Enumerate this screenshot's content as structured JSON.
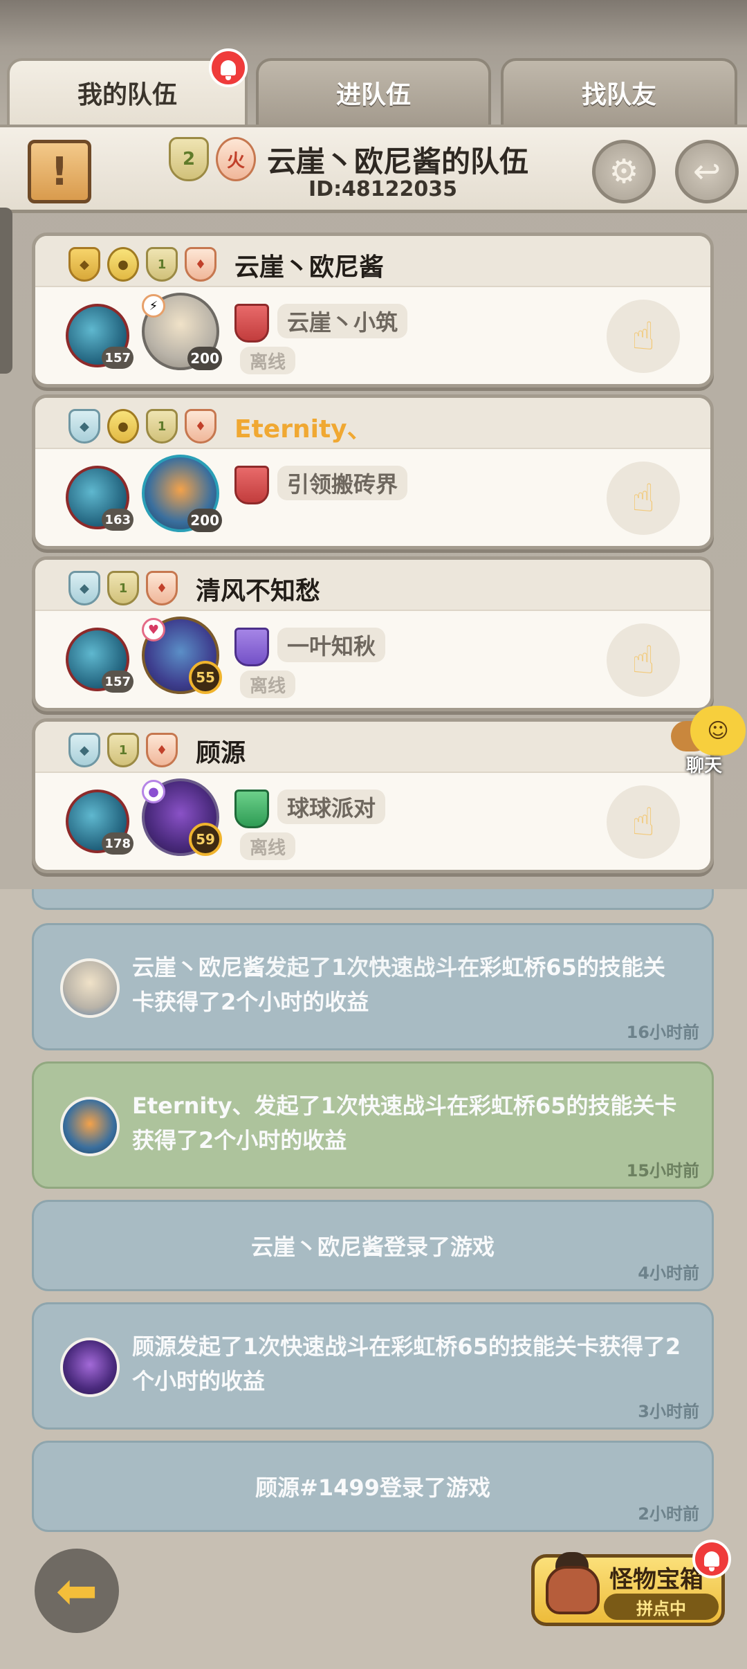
{
  "tabs": [
    {
      "label": "我的队伍",
      "active": true,
      "has_alert": true
    },
    {
      "label": "进队伍",
      "active": false
    },
    {
      "label": "找队友",
      "active": false
    }
  ],
  "header": {
    "team_title": "云崖丶欧尼酱的队伍",
    "team_id": "ID:48122035",
    "emblem_1": "2",
    "emblem_2": "火"
  },
  "members": [
    {
      "name": "云崖丶欧尼酱",
      "name_color": "dark",
      "hero_level": "157",
      "pet_level": "200",
      "guild": "云崖丶小筑",
      "status": "离线",
      "action_icon": "swap-hand-icon"
    },
    {
      "name": "Eternity、",
      "name_color": "gold",
      "hero_level": "163",
      "pet_level": "200",
      "guild": "引领搬砖界",
      "status": "",
      "action_icon": "tap-hand-icon"
    },
    {
      "name": "清风不知愁",
      "name_color": "dark",
      "hero_level": "157",
      "pet_level": "55",
      "guild": "一叶知秋",
      "status": "离线",
      "action_icon": "swap-hand-icon"
    },
    {
      "name": "顾源",
      "name_color": "dark",
      "hero_level": "178",
      "pet_level": "59",
      "guild": "球球派对",
      "status": "离线",
      "action_icon": "swap-hand-icon"
    }
  ],
  "chat": {
    "label": "聊天"
  },
  "logs": [
    {
      "text_parts": [
        "云崖丶欧尼酱",
        "发起了1次快速战斗在",
        "彩虹桥65",
        "的",
        "技能",
        "关卡获得了2个小时的收益"
      ],
      "time": "16小时前",
      "color": "blue",
      "has_avatar": true
    },
    {
      "text_parts": [
        "Eternity、",
        "发起了1次快速战斗在",
        "彩虹桥65",
        "的",
        "技能",
        "关卡获得了2个小时的收益"
      ],
      "time": "15小时前",
      "color": "green",
      "has_avatar": true
    },
    {
      "text_parts": [
        "云崖丶欧尼酱",
        "登录了游戏"
      ],
      "time": "4小时前",
      "color": "blue",
      "has_avatar": false
    },
    {
      "text_parts": [
        "顾源",
        "发起了1次快速战斗在",
        "彩虹桥65",
        "的",
        "技能",
        "关卡获得了2个小时的收益"
      ],
      "time": "3小时前",
      "color": "blue",
      "has_avatar": true
    },
    {
      "text_parts": [
        "顾源#1499",
        "登录了游戏"
      ],
      "time": "2小时前",
      "color": "blue",
      "has_avatar": false
    }
  ],
  "bottom": {
    "treasure_title": "怪物宝箱",
    "treasure_sub": "拼点中"
  },
  "colors": {
    "highlight_gold": "#f0a832",
    "alert_red": "#ef3b3b",
    "log_blue": "#a8bbc3",
    "log_green": "#adc39c"
  }
}
